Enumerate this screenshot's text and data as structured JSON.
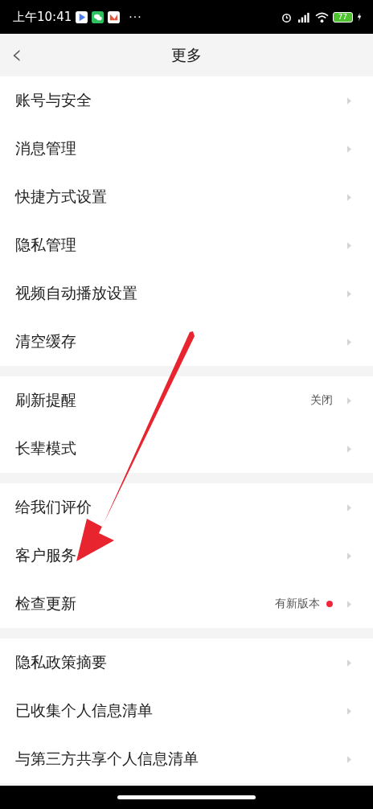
{
  "status_bar": {
    "time": "上午10:41",
    "more": "···",
    "battery": "77"
  },
  "header": {
    "back": "‹",
    "title": "更多"
  },
  "groups": [
    {
      "items": [
        {
          "label": "账号与安全",
          "dot": false
        },
        {
          "label": "消息管理",
          "dot": false
        },
        {
          "label": "快捷方式设置",
          "dot": false
        },
        {
          "label": "隐私管理",
          "dot": false
        },
        {
          "label": "视频自动播放设置",
          "dot": false
        },
        {
          "label": "清空缓存",
          "dot": false
        }
      ]
    },
    {
      "items": [
        {
          "label": "刷新提醒",
          "value": "关闭",
          "dot": false
        },
        {
          "label": "长辈模式",
          "dot": false
        }
      ]
    },
    {
      "items": [
        {
          "label": "给我们评价",
          "dot": false
        },
        {
          "label": "客户服务",
          "dot": false
        },
        {
          "label": "检查更新",
          "value": "有新版本",
          "dot": true
        }
      ]
    },
    {
      "items": [
        {
          "label": "隐私政策摘要",
          "dot": false
        },
        {
          "label": "已收集个人信息清单",
          "dot": false
        },
        {
          "label": "与第三方共享个人信息清单",
          "dot": false
        }
      ]
    }
  ]
}
